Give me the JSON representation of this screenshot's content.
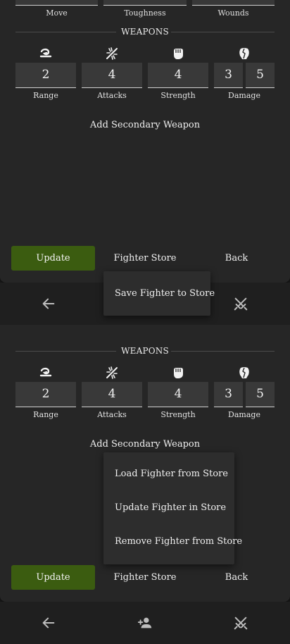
{
  "colors": {
    "background": "#1b1b1b",
    "panel": "#262626",
    "field": "#393939",
    "accent_green": "#3b5c10",
    "nav": "#1f1f1f",
    "menu": "#2d2d2d"
  },
  "top_stats": [
    "Move",
    "Toughness",
    "Wounds"
  ],
  "weapons": {
    "title": "WEAPONS",
    "icons": [
      "range-icon",
      "attacks-icon",
      "strength-icon",
      "damage-icon"
    ],
    "range": "2",
    "attacks": "4",
    "strength": "4",
    "damage_normal": "3",
    "damage_crit": "5",
    "labels": {
      "range": "Range",
      "attacks": "Attacks",
      "strength": "Strength",
      "damage": "Damage"
    },
    "add_secondary": "Add Secondary Weapon"
  },
  "actions": {
    "update": "Update",
    "fighter_store": "Fighter Store",
    "back": "Back"
  },
  "menu_top": {
    "items": [
      "Save Fighter to Store"
    ]
  },
  "menu_bottom": {
    "items": [
      "Load Fighter from Store",
      "Update Fighter in Store",
      "Remove Fighter from Store"
    ]
  },
  "nav": {
    "icons": [
      "back-arrow-icon",
      "add-person-icon",
      "crossed-swords-icon"
    ]
  }
}
